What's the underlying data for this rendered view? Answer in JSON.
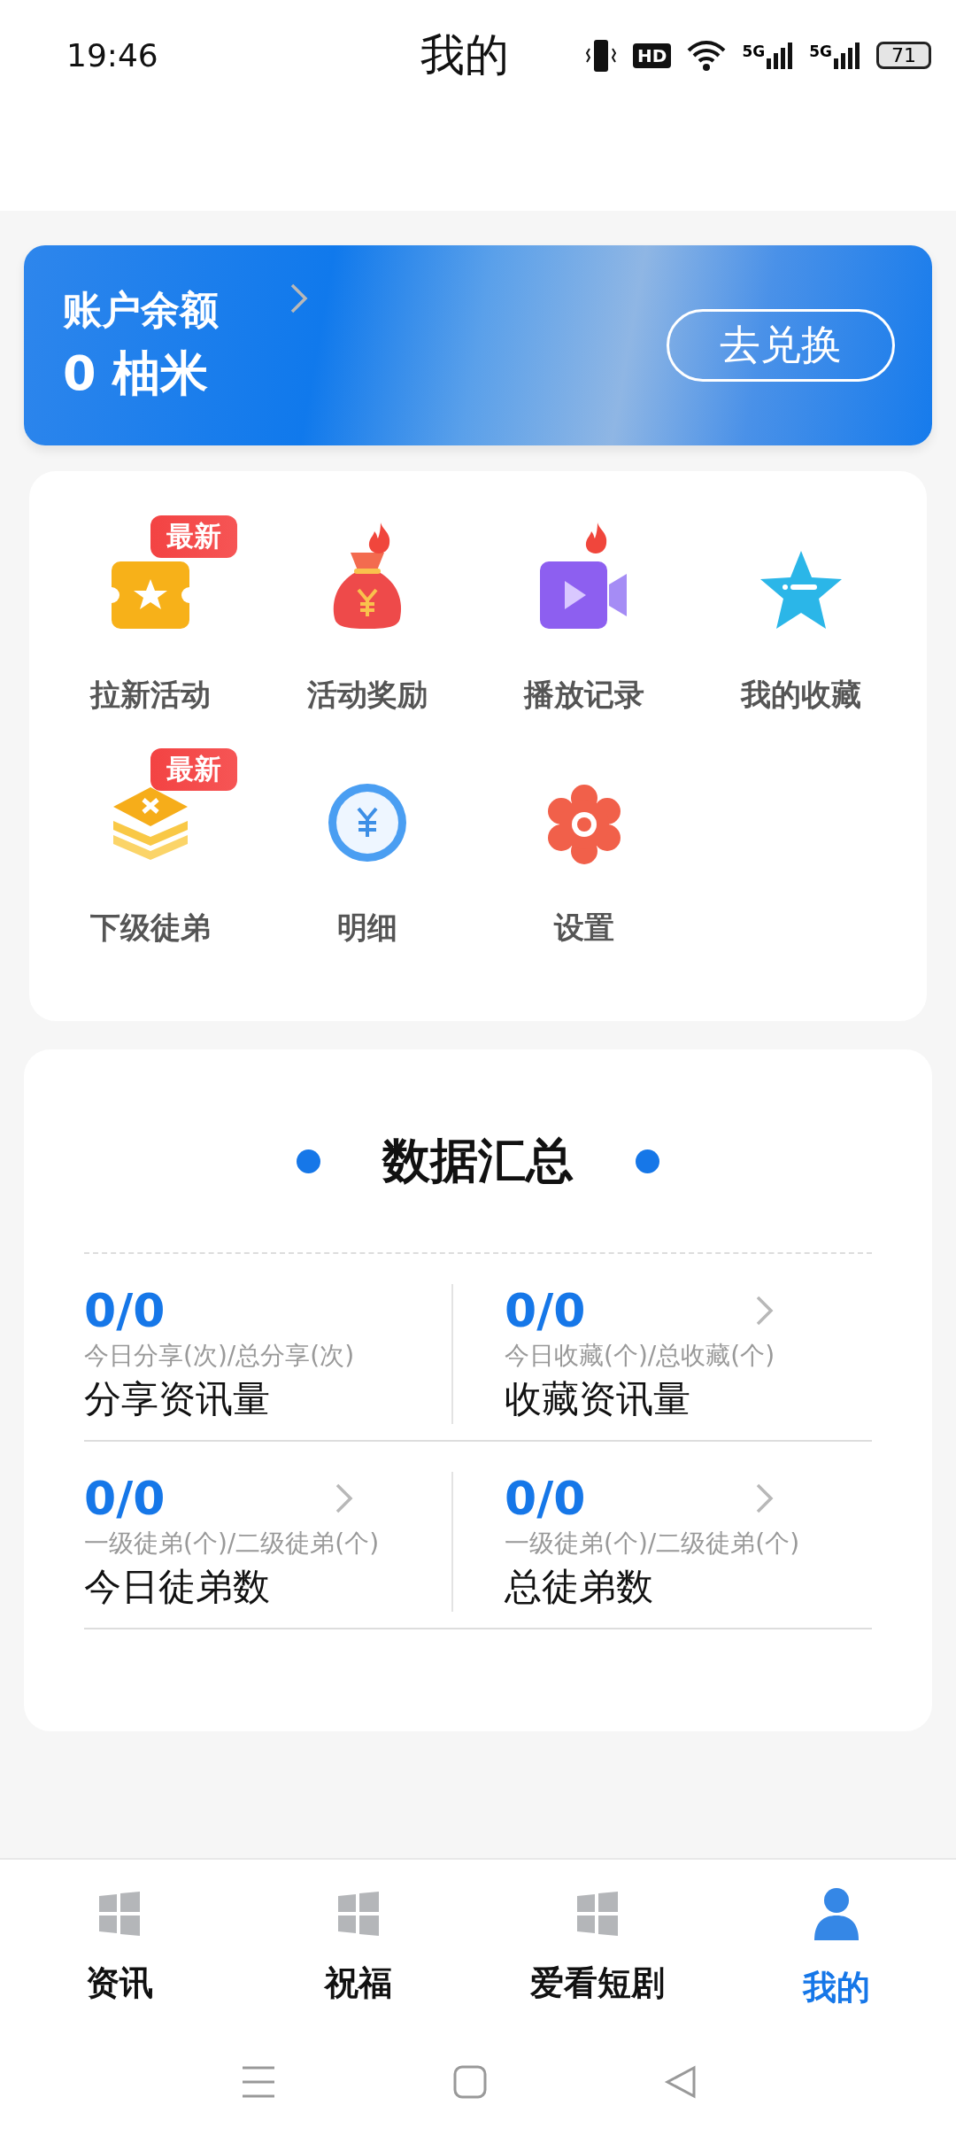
{
  "status_bar": {
    "time": "19:46",
    "hd": "HD",
    "signals": [
      "5G",
      "5G"
    ],
    "battery": "71"
  },
  "header": {
    "title": "我的"
  },
  "balance": {
    "label": "账户余额",
    "amount": "0 柚米",
    "button": "去兑换"
  },
  "menu": [
    {
      "label": "拉新活动",
      "badge": "最新",
      "hot": false
    },
    {
      "label": "活动奖励",
      "hot": true
    },
    {
      "label": "播放记录",
      "hot": true
    },
    {
      "label": "我的收藏",
      "hot": false
    },
    {
      "label": "下级徒弟",
      "badge": "最新",
      "hot": false
    },
    {
      "label": "明细",
      "hot": false
    },
    {
      "label": "设置",
      "hot": false
    }
  ],
  "summary": {
    "title": "数据汇总",
    "rows": [
      [
        {
          "value": "0/0",
          "caption": "今日分享(次)/总分享(次)",
          "label": "分享资讯量",
          "arrow": false
        },
        {
          "value": "0/0",
          "caption": "今日收藏(个)/总收藏(个)",
          "label": "收藏资讯量",
          "arrow": true
        }
      ],
      [
        {
          "value": "0/0",
          "caption": "一级徒弟(个)/二级徒弟(个)",
          "label": "今日徒弟数",
          "arrow": true
        },
        {
          "value": "0/0",
          "caption": "一级徒弟(个)/二级徒弟(个)",
          "label": "总徒弟数",
          "arrow": true
        }
      ]
    ]
  },
  "tabs": [
    {
      "label": "资讯",
      "selected": false
    },
    {
      "label": "祝福",
      "selected": false
    },
    {
      "label": "爱看短剧",
      "selected": false
    },
    {
      "label": "我的",
      "selected": true
    }
  ]
}
